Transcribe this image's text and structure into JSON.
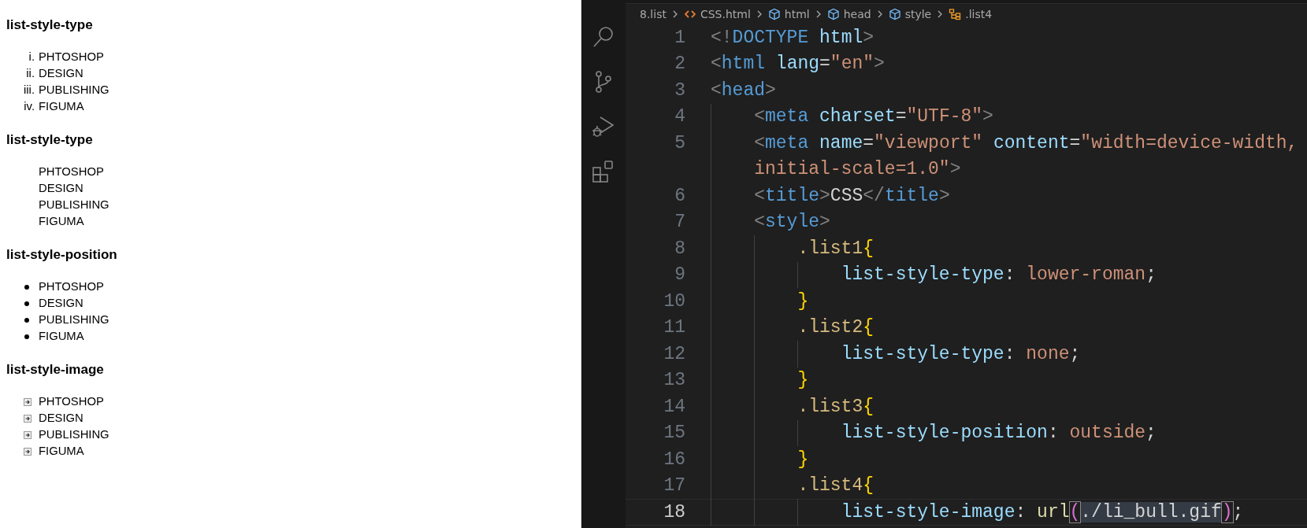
{
  "preview": {
    "sections": [
      {
        "heading": "list-style-type",
        "kind": "roman",
        "items": [
          {
            "marker": "i.",
            "label": "PHTOSHOP"
          },
          {
            "marker": "ii.",
            "label": "DESIGN"
          },
          {
            "marker": "iii.",
            "label": "PUBLISHING"
          },
          {
            "marker": "iv.",
            "label": "FIGUMA"
          }
        ]
      },
      {
        "heading": "list-style-type",
        "kind": "plain",
        "items": [
          {
            "label": "PHTOSHOP"
          },
          {
            "label": "DESIGN"
          },
          {
            "label": "PUBLISHING"
          },
          {
            "label": "FIGUMA"
          }
        ]
      },
      {
        "heading": "list-style-position",
        "kind": "bullet",
        "items": [
          {
            "label": "PHTOSHOP"
          },
          {
            "label": "DESIGN"
          },
          {
            "label": "PUBLISHING"
          },
          {
            "label": "FIGUMA"
          }
        ]
      },
      {
        "heading": "list-style-image",
        "kind": "image",
        "items": [
          {
            "label": "PHTOSHOP"
          },
          {
            "label": "DESIGN"
          },
          {
            "label": "PUBLISHING"
          },
          {
            "label": "FIGUMA"
          }
        ]
      }
    ]
  },
  "activity_bar": {
    "icons": [
      {
        "kind": "search"
      },
      {
        "kind": "branch"
      },
      {
        "kind": "debug"
      },
      {
        "kind": "extensions"
      }
    ]
  },
  "breadcrumb": [
    {
      "kind": "folder",
      "label": "8.list"
    },
    {
      "kind": "file",
      "label": "CSS.html"
    },
    {
      "kind": "element",
      "label": "html"
    },
    {
      "kind": "element",
      "label": "head"
    },
    {
      "kind": "element",
      "label": "style"
    },
    {
      "kind": "selector",
      "label": ".list4"
    }
  ],
  "editor": {
    "rows": [
      {
        "number": "1",
        "active": false,
        "code": [
          {
            "kind": "punct",
            "text": "<!"
          },
          {
            "kind": "tag",
            "text": "DOCTYPE"
          },
          {
            "kind": "attr",
            "text": " html"
          },
          {
            "kind": "punct",
            "text": ">"
          }
        ]
      },
      {
        "number": "2",
        "active": false,
        "code": [
          {
            "kind": "punct",
            "text": "<"
          },
          {
            "kind": "tag",
            "text": "html"
          },
          {
            "kind": "attr",
            "text": " lang"
          },
          {
            "kind": "plain",
            "text": "="
          },
          {
            "kind": "string",
            "text": "\"en\""
          },
          {
            "kind": "punct",
            "text": ">"
          }
        ]
      },
      {
        "number": "3",
        "active": false,
        "code": [
          {
            "kind": "punct",
            "text": "<"
          },
          {
            "kind": "tag",
            "text": "head"
          },
          {
            "kind": "punct",
            "text": ">"
          }
        ],
        "children": [
          {
            "number": "4",
            "active": false,
            "code": [
              {
                "kind": "punct",
                "text": "<"
              },
              {
                "kind": "tag",
                "text": "meta"
              },
              {
                "kind": "attr",
                "text": " charset"
              },
              {
                "kind": "plain",
                "text": "="
              },
              {
                "kind": "string",
                "text": "\"UTF-8\""
              },
              {
                "kind": "punct",
                "text": ">"
              }
            ]
          },
          {
            "number": "5",
            "active": false,
            "code": [
              {
                "kind": "punct",
                "text": "<"
              },
              {
                "kind": "tag",
                "text": "meta"
              },
              {
                "kind": "attr",
                "text": " name"
              },
              {
                "kind": "plain",
                "text": "="
              },
              {
                "kind": "string",
                "text": "\"viewport\""
              },
              {
                "kind": "attr",
                "text": " content"
              },
              {
                "kind": "plain",
                "text": "="
              },
              {
                "kind": "string",
                "text": "\"width=device-width,"
              }
            ],
            "continuation": [
              {
                "kind": "string",
                "text": "initial-scale=1.0\""
              },
              {
                "kind": "punct",
                "text": ">"
              }
            ]
          },
          {
            "number": "6",
            "active": false,
            "code": [
              {
                "kind": "punct",
                "text": "<"
              },
              {
                "kind": "tag",
                "text": "title"
              },
              {
                "kind": "punct",
                "text": ">"
              },
              {
                "kind": "plain",
                "text": "CSS"
              },
              {
                "kind": "punct",
                "text": "</"
              },
              {
                "kind": "tag",
                "text": "title"
              },
              {
                "kind": "punct",
                "text": ">"
              }
            ]
          },
          {
            "number": "7",
            "active": false,
            "code": [
              {
                "kind": "punct",
                "text": "<"
              },
              {
                "kind": "tag",
                "text": "style"
              },
              {
                "kind": "punct",
                "text": ">"
              }
            ],
            "children": [
              {
                "number": "8",
                "active": false,
                "code": [
                  {
                    "kind": "selector",
                    "text": ".list1"
                  },
                  {
                    "kind": "brace",
                    "text": "{"
                  }
                ],
                "children": [
                  {
                    "number": "9",
                    "active": false,
                    "code": [
                      {
                        "kind": "property",
                        "text": "list-style-type"
                      },
                      {
                        "kind": "plain",
                        "text": ":"
                      },
                      {
                        "kind": "value",
                        "text": " lower-roman"
                      },
                      {
                        "kind": "plain",
                        "text": ";"
                      }
                    ]
                  }
                ]
              },
              {
                "number": "10",
                "active": false,
                "code": [
                  {
                    "kind": "brace",
                    "text": "}"
                  }
                ]
              },
              {
                "number": "11",
                "active": false,
                "code": [
                  {
                    "kind": "selector",
                    "text": ".list2"
                  },
                  {
                    "kind": "brace",
                    "text": "{"
                  }
                ],
                "children": [
                  {
                    "number": "12",
                    "active": false,
                    "code": [
                      {
                        "kind": "property",
                        "text": "list-style-type"
                      },
                      {
                        "kind": "plain",
                        "text": ":"
                      },
                      {
                        "kind": "value",
                        "text": " none"
                      },
                      {
                        "kind": "plain",
                        "text": ";"
                      }
                    ]
                  }
                ]
              },
              {
                "number": "13",
                "active": false,
                "code": [
                  {
                    "kind": "brace",
                    "text": "}"
                  }
                ]
              },
              {
                "number": "14",
                "active": false,
                "code": [
                  {
                    "kind": "selector",
                    "text": ".list3"
                  },
                  {
                    "kind": "brace",
                    "text": "{"
                  }
                ],
                "children": [
                  {
                    "number": "15",
                    "active": false,
                    "code": [
                      {
                        "kind": "property",
                        "text": "list-style-position"
                      },
                      {
                        "kind": "plain",
                        "text": ":"
                      },
                      {
                        "kind": "value",
                        "text": " outside"
                      },
                      {
                        "kind": "plain",
                        "text": ";"
                      }
                    ]
                  }
                ]
              },
              {
                "number": "16",
                "active": false,
                "code": [
                  {
                    "kind": "brace",
                    "text": "}"
                  }
                ]
              },
              {
                "number": "17",
                "active": false,
                "code": [
                  {
                    "kind": "selector",
                    "text": ".list4"
                  },
                  {
                    "kind": "brace",
                    "text": "{"
                  }
                ],
                "children": [
                  {
                    "number": "18",
                    "active": true,
                    "code": [
                      {
                        "kind": "property",
                        "text": "list-style-image"
                      },
                      {
                        "kind": "plain",
                        "text": ":"
                      },
                      {
                        "kind": "function",
                        "text": " url"
                      },
                      {
                        "kind": "paren",
                        "text": "("
                      },
                      {
                        "kind": "url",
                        "text": "./li_bull.gif"
                      },
                      {
                        "kind": "paren",
                        "text": ")"
                      },
                      {
                        "kind": "plain",
                        "text": ";"
                      }
                    ]
                  }
                ]
              }
            ]
          }
        ]
      }
    ]
  }
}
